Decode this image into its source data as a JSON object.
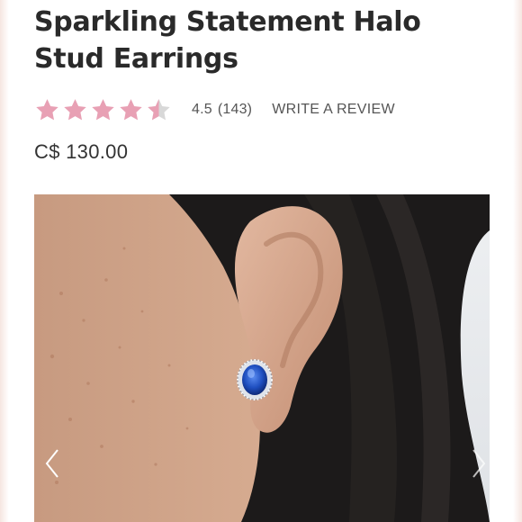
{
  "product": {
    "title": "Sparkling Statement Halo Stud Earrings",
    "price": "C$ 130.00"
  },
  "rating": {
    "value": 4.5,
    "value_text": "4.5",
    "count_text": "(143)",
    "max_stars": 5,
    "star_color": "#e8a0b4",
    "star_empty_color": "#d8d8d8",
    "write_review_label": "WRITE A REVIEW"
  },
  "gallery": {
    "prev_icon": "chevron-left-icon",
    "next_icon": "chevron-right-icon"
  }
}
